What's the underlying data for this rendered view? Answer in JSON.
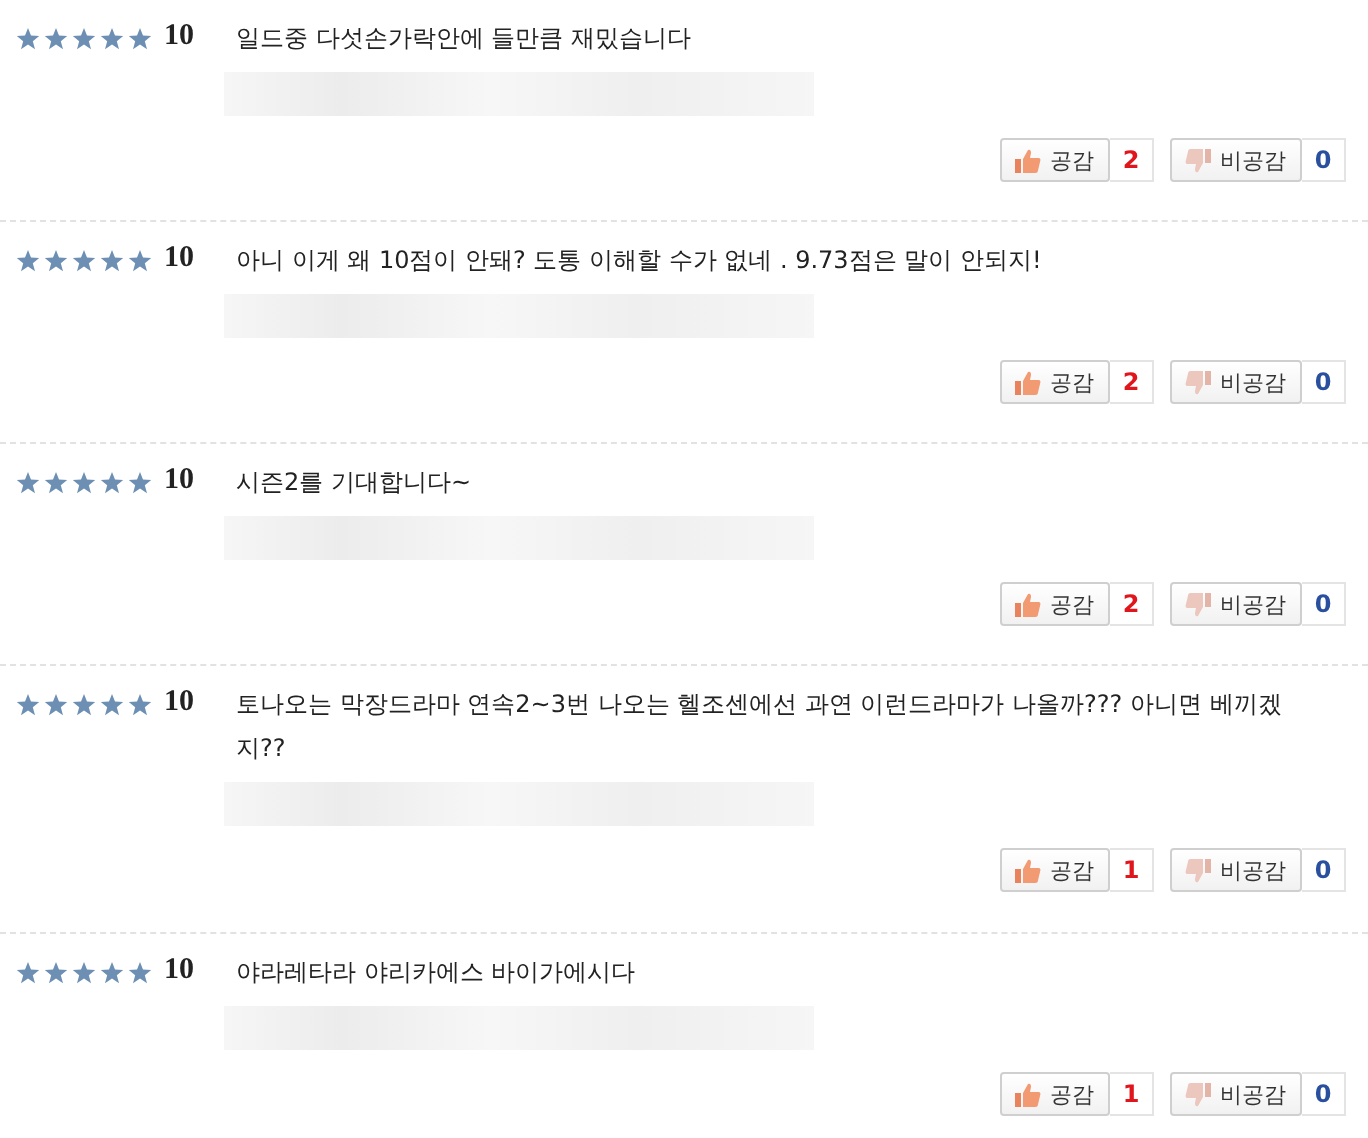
{
  "reviews": [
    {
      "stars": 5,
      "score": "10",
      "text": "일드중 다섯손가락안에 들만큼 재밌습니다",
      "agree": {
        "label": "공감",
        "count": "2"
      },
      "disagree": {
        "label": "비공감",
        "count": "0"
      }
    },
    {
      "stars": 5,
      "score": "10",
      "text": "아니 이게 왜 10점이 안돼? 도통 이해할 수가 없네 . 9.73점은 말이 안되지!",
      "agree": {
        "label": "공감",
        "count": "2"
      },
      "disagree": {
        "label": "비공감",
        "count": "0"
      }
    },
    {
      "stars": 5,
      "score": "10",
      "text": "시즌2를 기대합니다~",
      "agree": {
        "label": "공감",
        "count": "2"
      },
      "disagree": {
        "label": "비공감",
        "count": "0"
      }
    },
    {
      "stars": 5,
      "score": "10",
      "text": "토나오는 막장드라마 연속2~3번 나오는 헬조센에선 과연 이런드라마가 나올까??? 아니면 베끼겠지??",
      "agree": {
        "label": "공감",
        "count": "1"
      },
      "disagree": {
        "label": "비공감",
        "count": "0"
      }
    },
    {
      "stars": 5,
      "score": "10",
      "text": "야라레타라 야리카에스 바이가에시다",
      "agree": {
        "label": "공감",
        "count": "1"
      },
      "disagree": {
        "label": "비공감",
        "count": "0"
      }
    }
  ]
}
